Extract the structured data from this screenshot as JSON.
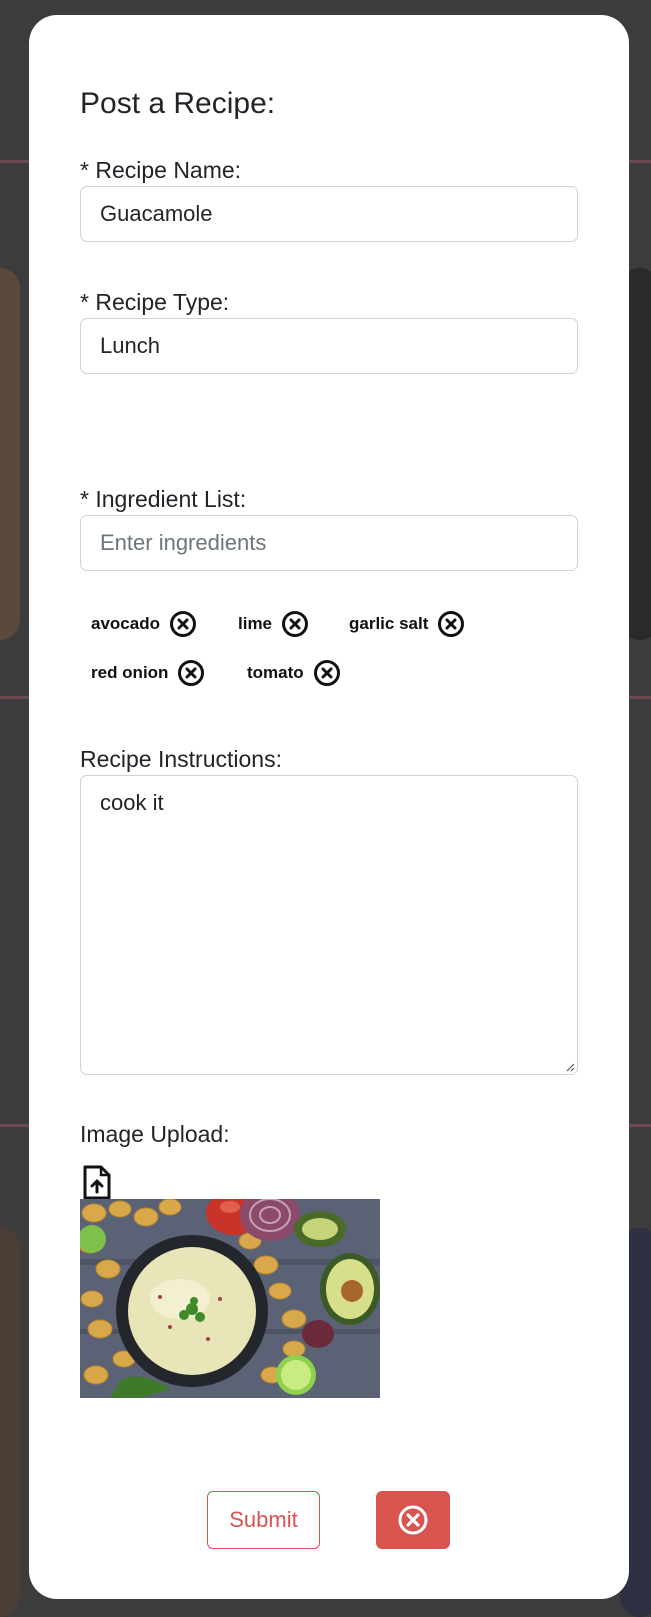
{
  "modal": {
    "title": "Post a Recipe:",
    "recipe_name": {
      "label": "* Recipe Name:",
      "value": "Guacamole"
    },
    "recipe_type": {
      "label": "* Recipe Type:",
      "value": "Lunch"
    },
    "ingredient_list": {
      "label": "* Ingredient List:",
      "placeholder": "Enter ingredients",
      "tags": [
        "avocado",
        "lime",
        "garlic salt",
        "red onion",
        "tomato"
      ]
    },
    "instructions": {
      "label": "Recipe Instructions:",
      "value": "cook it"
    },
    "image_upload": {
      "label": "Image Upload:",
      "icon": "file-upload-icon"
    },
    "buttons": {
      "submit": "Submit",
      "cancel_icon": "close-circle-icon"
    }
  },
  "colors": {
    "accent": "#d9534f",
    "overlay": "#3c3c3c",
    "input_border": "#ced4da"
  }
}
